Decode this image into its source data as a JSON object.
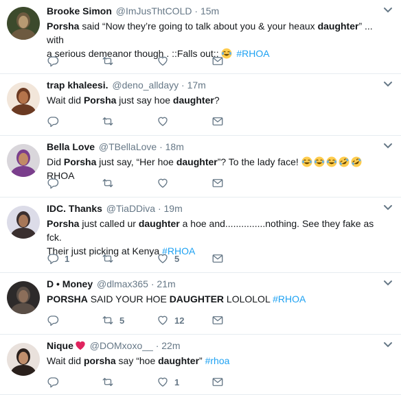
{
  "tweets": [
    {
      "name": "Brooke Simon",
      "handle": "@ImJusThtCOLD",
      "sep": "·",
      "time": "15m",
      "avatar": "avatar-brooke",
      "line1": [
        {
          "b": "Porsha"
        },
        {
          "t": " said “Now they’re going to talk about you & your heaux "
        },
        {
          "b": "daughter"
        },
        {
          "t": "” ... with"
        }
      ],
      "line2": [
        {
          "t": "a serious demeanor though . ::Falls out:: "
        },
        {
          "e": "joy"
        },
        {
          "t": " "
        },
        {
          "h": "#RHOA"
        }
      ],
      "replies": "",
      "retweets": "",
      "likes": ""
    },
    {
      "name": "trap khaleesi.",
      "handle": "@deno_alldayy",
      "sep": "·",
      "time": "17m",
      "avatar": "avatar-trap",
      "line1": [
        {
          "t": "Wait did "
        },
        {
          "b": "Porsha"
        },
        {
          "t": " just say hoe "
        },
        {
          "b": "daughter"
        },
        {
          "t": "?"
        }
      ],
      "replies": "",
      "retweets": "",
      "likes": ""
    },
    {
      "name": "Bella Love",
      "handle": "@TBellaLove",
      "sep": "·",
      "time": "18m",
      "avatar": "avatar-bella",
      "line1": [
        {
          "t": "Did "
        },
        {
          "b": "Porsha"
        },
        {
          "t": " just say, “Her hoe "
        },
        {
          "b": "daughter"
        },
        {
          "t": "”? To the lady face! "
        },
        {
          "e": "joy"
        },
        {
          "e": "joy"
        },
        {
          "e": "joy"
        },
        {
          "e": "rofl"
        },
        {
          "e": "rofl"
        },
        {
          "t": " RHOA"
        }
      ],
      "replies": "",
      "retweets": "",
      "likes": ""
    },
    {
      "name": "IDC. Thanks",
      "handle": "@TiaDDiva",
      "sep": "·",
      "time": "19m",
      "avatar": "avatar-idc",
      "line1": [
        {
          "b": "Porsha"
        },
        {
          "t": " just called ur "
        },
        {
          "b": "daughter"
        },
        {
          "t": " a hoe and...............nothing. See they fake as fck."
        }
      ],
      "line2": [
        {
          "t": "Their just picking at Kenya "
        },
        {
          "h": "#RHOA"
        }
      ],
      "replies": "1",
      "retweets": "",
      "likes": "5"
    },
    {
      "name": "D • Money",
      "handle": "@dlmax365",
      "sep": "·",
      "time": "21m",
      "avatar": "avatar-dmoney",
      "line1": [
        {
          "b": "PORSHA"
        },
        {
          "t": " SAID YOUR HOE "
        },
        {
          "b": "DAUGHTER"
        },
        {
          "t": " LOLOLOL "
        },
        {
          "h": "#RHOA"
        }
      ],
      "replies": "",
      "retweets": "5",
      "likes": "12"
    },
    {
      "name": "Nique",
      "handle": "@DOMxoxo__",
      "sep": "·",
      "time": "22m",
      "avatar": "avatar-nique",
      "heart": true,
      "line1": [
        {
          "t": "Wait did "
        },
        {
          "b": "porsha"
        },
        {
          "t": " say “hoe "
        },
        {
          "b": "daughter"
        },
        {
          "t": "” "
        },
        {
          "h": "#rhoa"
        }
      ],
      "replies": "",
      "retweets": "",
      "likes": "1"
    }
  ],
  "colors": {
    "text": "#14171a",
    "muted": "#657786",
    "hashtag": "#1da1f2",
    "divider": "#e6ecf0",
    "heart_badge": "#e0245e"
  }
}
